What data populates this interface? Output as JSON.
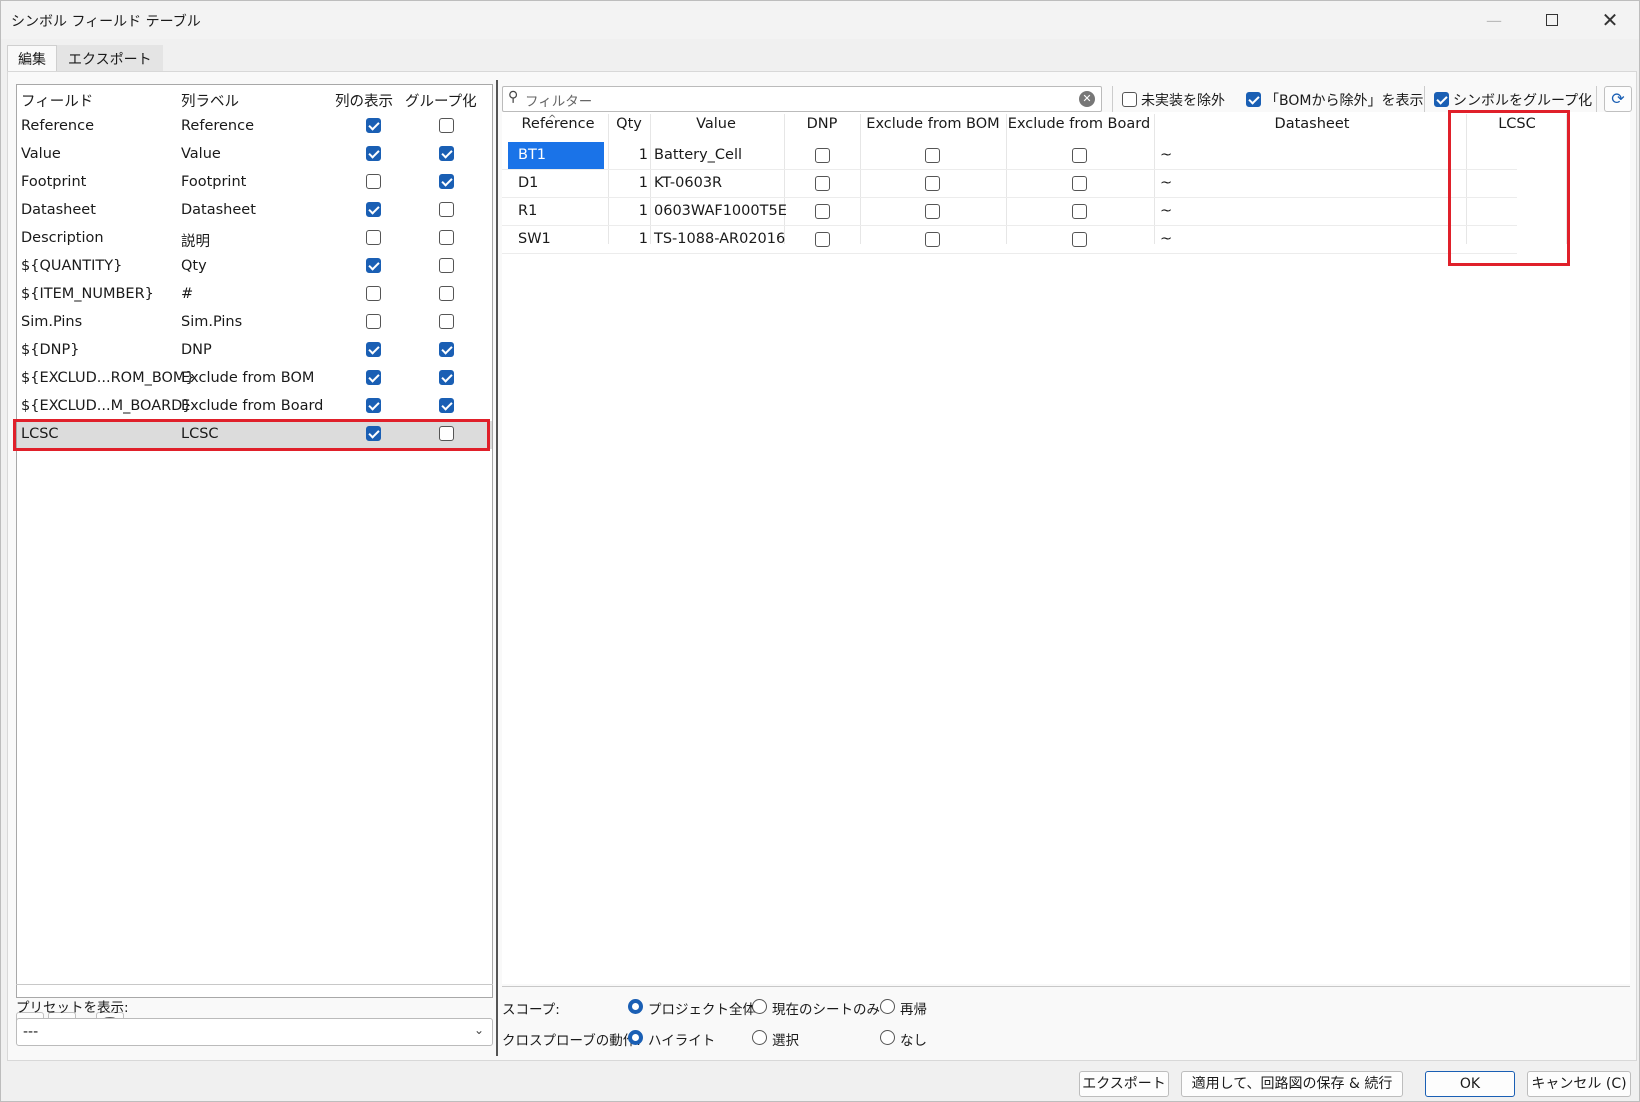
{
  "window": {
    "title": "シンボル フィールド テーブル",
    "minimize": "—",
    "maximize": "",
    "close": "✕"
  },
  "tabs": [
    {
      "label": "編集",
      "active": true
    },
    {
      "label": "エクスポート",
      "active": false
    }
  ],
  "field_list": {
    "headers": {
      "field": "フィールド",
      "label": "列ラベル",
      "show": "列の表示",
      "group": "グループ化"
    },
    "rows": [
      {
        "field": "Reference",
        "label": "Reference",
        "show": true,
        "group": false
      },
      {
        "field": "Value",
        "label": "Value",
        "show": true,
        "group": true
      },
      {
        "field": "Footprint",
        "label": "Footprint",
        "show": false,
        "group": true
      },
      {
        "field": "Datasheet",
        "label": "Datasheet",
        "show": true,
        "group": false
      },
      {
        "field": "Description",
        "label": "説明",
        "show": false,
        "group": false
      },
      {
        "field": "${QUANTITY}",
        "label": "Qty",
        "show": true,
        "group": false
      },
      {
        "field": "${ITEM_NUMBER}",
        "label": "#",
        "show": false,
        "group": false
      },
      {
        "field": "Sim.Pins",
        "label": "Sim.Pins",
        "show": false,
        "group": false
      },
      {
        "field": "${DNP}",
        "label": "DNP",
        "show": true,
        "group": true
      },
      {
        "field": "${EXCLUD...ROM_BOM}",
        "label": "Exclude from BOM",
        "show": true,
        "group": true
      },
      {
        "field": "${EXCLUD...M_BOARD}",
        "label": "Exclude from Board",
        "show": true,
        "group": true
      },
      {
        "field": "LCSC",
        "label": "LCSC",
        "show": true,
        "group": false,
        "selected": true
      }
    ],
    "toolbar_icons": [
      "add-icon",
      "edit-icon",
      "delete-icon"
    ],
    "toolbar_glyphs": {
      "add": "+",
      "edit": "✎",
      "delete": "🗑"
    }
  },
  "preset": {
    "label": "プリセットを表示:",
    "value": "---",
    "arrow": "⌄"
  },
  "filter": {
    "placeholder": "フィルター",
    "search_glyph": "⚲",
    "clear_glyph": "✕"
  },
  "options": {
    "exclude_dnp": {
      "label": "未実装を除外",
      "checked": false
    },
    "show_excluded_bom": {
      "label": "「BOMから除外」を表示",
      "checked": true
    },
    "group_symbols": {
      "label": "シンボルをグループ化",
      "checked": true
    },
    "refresh_glyph": "⟳"
  },
  "grid": {
    "columns": [
      "Reference",
      "Qty",
      "Value",
      "DNP",
      "Exclude from BOM",
      "Exclude from Board",
      "Datasheet",
      "LCSC"
    ],
    "sort_glyph": "^",
    "rows": [
      {
        "ref": "BT1",
        "qty": "1",
        "value": "Battery_Cell",
        "dnp": false,
        "excl_bom": false,
        "excl_board": false,
        "datasheet": "~",
        "lcsc": ""
      },
      {
        "ref": "D1",
        "qty": "1",
        "value": "KT-0603R",
        "dnp": false,
        "excl_bom": false,
        "excl_board": false,
        "datasheet": "~",
        "lcsc": ""
      },
      {
        "ref": "R1",
        "qty": "1",
        "value": "0603WAF1000T5E",
        "dnp": false,
        "excl_bom": false,
        "excl_board": false,
        "datasheet": "~",
        "lcsc": ""
      },
      {
        "ref": "SW1",
        "qty": "1",
        "value": "TS-1088-AR02016",
        "dnp": false,
        "excl_bom": false,
        "excl_board": false,
        "datasheet": "~",
        "lcsc": ""
      }
    ]
  },
  "scope": {
    "label": "スコープ:",
    "options": [
      {
        "label": "プロジェクト全体",
        "selected": true
      },
      {
        "label": "現在のシートのみ",
        "selected": false
      },
      {
        "label": "再帰",
        "selected": false
      }
    ]
  },
  "crossprobe": {
    "label": "クロスプローブの動作:",
    "options": [
      {
        "label": "ハイライト",
        "selected": true
      },
      {
        "label": "選択",
        "selected": false
      },
      {
        "label": "なし",
        "selected": false
      }
    ]
  },
  "buttons": {
    "export": "エクスポート",
    "apply": "適用して、回路図の保存 & 続行",
    "ok": "OK",
    "cancel": "キャンセル (C)"
  },
  "colors": {
    "accent": "#1a5fb4",
    "selection": "#1a73e8",
    "highlight_box": "#e0202a"
  }
}
